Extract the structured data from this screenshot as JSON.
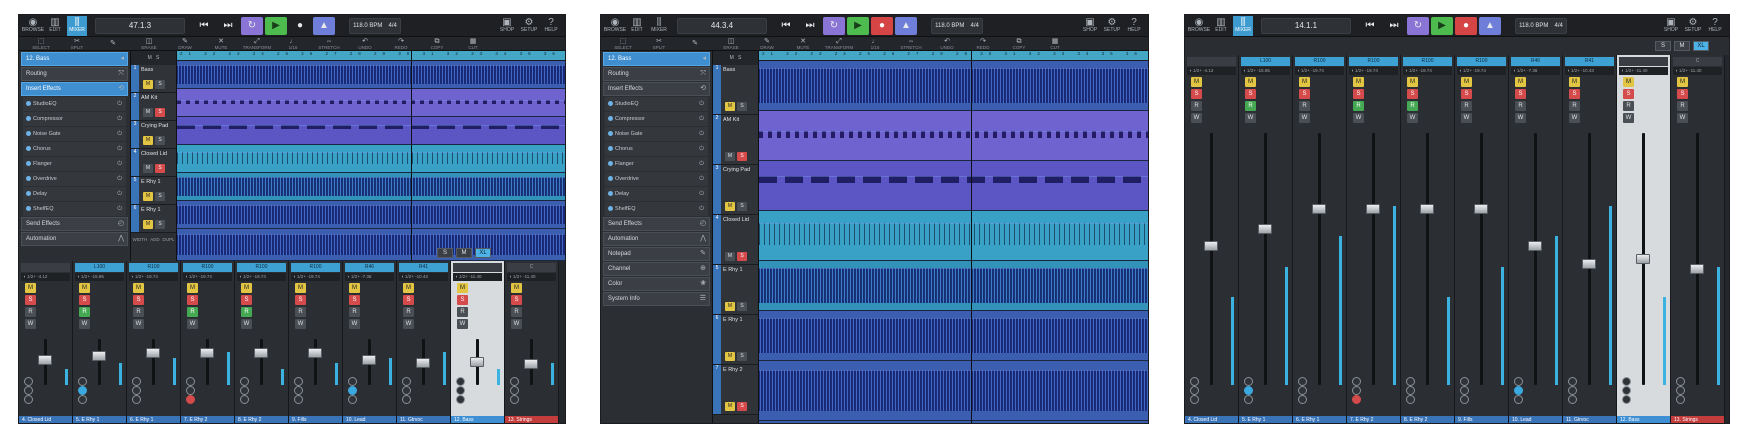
{
  "transport": {
    "left_buttons": [
      {
        "label": "BROWSE",
        "icon": "browse-icon",
        "glyph": "◉"
      },
      {
        "label": "EDIT",
        "icon": "edit-icon",
        "glyph": "▥"
      },
      {
        "label": "MIXER",
        "icon": "mixer-icon",
        "glyph": "⫼"
      }
    ],
    "right_buttons": [
      {
        "label": "SHOP",
        "icon": "shop-icon",
        "glyph": "▣"
      },
      {
        "label": "SETUP",
        "icon": "gear-icon",
        "glyph": "⚙"
      },
      {
        "label": "HELP",
        "icon": "help-icon",
        "glyph": "?"
      }
    ],
    "tempo": "118.0 BPM",
    "signature": "4/4",
    "rewind_glyph": "⏮",
    "forward_glyph": "⏭",
    "loop_glyph": "↻",
    "play_glyph": "▶",
    "record_glyph": "●",
    "metronome_glyph": "▲"
  },
  "panels": [
    {
      "position": "47.1.3"
    },
    {
      "position": "44.3.4"
    },
    {
      "position": "14.1.1"
    }
  ],
  "tools": [
    {
      "label": "SELECT",
      "glyph": "⬚"
    },
    {
      "label": "SPLIT",
      "glyph": "✂"
    },
    {
      "label": "",
      "glyph": "✎"
    },
    {
      "label": "ERASE",
      "glyph": "◫"
    },
    {
      "label": "DRAW",
      "glyph": "✎"
    },
    {
      "label": "MUTE",
      "glyph": "✕"
    },
    {
      "label": "TRANSFORM",
      "glyph": "⤢"
    },
    {
      "label": "1/16",
      "glyph": "♩"
    },
    {
      "label": "STRETCH",
      "glyph": "⇔"
    },
    {
      "label": "UNDO",
      "glyph": "↶"
    },
    {
      "label": "REDO",
      "glyph": "↷"
    },
    {
      "label": "COPY",
      "glyph": "⧉"
    },
    {
      "label": "CUT",
      "glyph": "▦"
    }
  ],
  "inspector": {
    "track_name": "12. Bass",
    "sections": [
      "Routing",
      "Insert Effects"
    ],
    "effects": [
      "StudioEQ",
      "Compressor",
      "Noise Gate",
      "Chorus",
      "Flanger",
      "Overdrive",
      "Delay",
      "ShelfEQ"
    ],
    "bottom_sections": [
      "Send Effects",
      "Automation"
    ],
    "extra_sections": [
      "Notepad",
      "Channel",
      "Color",
      "System Info"
    ]
  },
  "tracks": [
    {
      "num": "1",
      "name": "Bass",
      "type": "ebass"
    },
    {
      "num": "2",
      "name": "AM Kit",
      "type": "drum"
    },
    {
      "num": "3",
      "name": "Crying Pad",
      "type": "pad"
    },
    {
      "num": "4",
      "name": "Closed Lid",
      "type": "hat"
    },
    {
      "num": "5",
      "name": "E Rhy 1",
      "type": "cyan"
    },
    {
      "num": "6",
      "name": "E Rhy 1",
      "type": "ebass"
    },
    {
      "num": "7",
      "name": "E Rhy 2",
      "type": "ebass"
    }
  ],
  "track_buttons": {
    "mute": "M",
    "solo": "S"
  },
  "ruler_ticks": "21 22 23 24 25 26 27 28 29 30 31 32 33 34 35 36 37 38 39 40 41 42 43 44 45 46 47 48 49 50",
  "size_buttons": [
    "S",
    "M",
    "XL"
  ],
  "footer_tools": [
    "WIDTH",
    "ADD",
    "DUPL"
  ],
  "mixer": {
    "channels": [
      {
        "top": "",
        "pan": "◖ 1/2+ -4.12",
        "name": "4. Closed Lid",
        "rec": false
      },
      {
        "top": "L100",
        "pan": "◖ 1/2+ -15.95",
        "name": "5. E Rhy 1",
        "rec": true
      },
      {
        "top": "R100",
        "pan": "◖ 1/2+ -19.74",
        "name": "6. E Rhy 1",
        "rec": false
      },
      {
        "top": "R100",
        "pan": "◖ 1/2+ -19.74",
        "name": "7. E Rhy 2",
        "rec": true
      },
      {
        "top": "R100",
        "pan": "◖ 1/2+ -19.74",
        "name": "8. E Rhy 2",
        "rec": true
      },
      {
        "top": "R100",
        "pan": "◖ 1/2+ -19.74",
        "name": "9. Fills",
        "rec": false
      },
      {
        "top": "R46",
        "pan": "◖ 1/2+ -7.36",
        "name": "10. Lead",
        "rec": false
      },
      {
        "top": "R41",
        "pan": "◖ 1/2+ -10.43",
        "name": "11. Gtrvoc",
        "rec": false
      },
      {
        "top": "",
        "pan": "◖ 1/2+ -11.40",
        "name": "12. Bass",
        "rec": false
      },
      {
        "top": "C",
        "pan": "◖ 1/2+ -11.40",
        "name": "13. Strings",
        "rec": false
      }
    ],
    "button_labels": {
      "mute": "M",
      "solo": "S",
      "record": "R",
      "write": "W"
    }
  },
  "colors": {
    "accent": "#3d9bd0",
    "track_blue": "#3a5ea8",
    "drum_purple": "#6f63cf",
    "hat_cyan": "#3aa1c6",
    "play_green": "#4dbb4d",
    "record_red": "#d64545"
  }
}
